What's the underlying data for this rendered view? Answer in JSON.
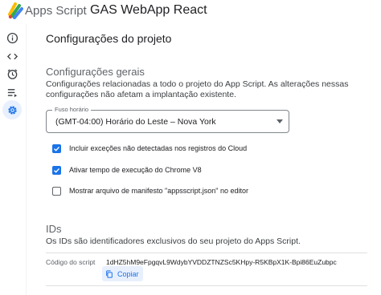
{
  "header": {
    "brand": "Apps Script",
    "project_name": "GAS WebApp React"
  },
  "rail": {
    "items": [
      {
        "icon": "info-icon",
        "active": false
      },
      {
        "icon": "code-icon",
        "active": false
      },
      {
        "icon": "clock-icon",
        "active": false
      },
      {
        "icon": "executions-icon",
        "active": false
      },
      {
        "icon": "gear-icon",
        "active": true
      }
    ]
  },
  "page": {
    "title": "Configurações do projeto"
  },
  "general": {
    "title": "Configurações gerais",
    "description": "Configurações relacionadas a todo o projeto do App Script. As alterações nessas configurações não afetam a implantação existente.",
    "timezone": {
      "label": "Fuso horário",
      "value": "(GMT-04:00) Horário do Leste – Nova York"
    },
    "options": [
      {
        "label": "Incluir exceções não detectadas nos registros do Cloud",
        "checked": true
      },
      {
        "label": "Ativar tempo de execução do Chrome V8",
        "checked": true
      },
      {
        "label": "Mostrar arquivo de manifesto \"appsscript.json\" no editor",
        "checked": false
      }
    ]
  },
  "ids": {
    "title": "IDs",
    "description": "Os IDs são identificadores exclusivos do seu projeto do Apps Script.",
    "script_label": "Código do script",
    "script_id": "1dHZ5hM9eFpgqvL9WdybYVDDZTNZSc5KHpy-R5KBpX1K-Bpi86EuZubpc",
    "copy_label": "Copiar"
  },
  "colors": {
    "accent": "#1a73e8",
    "active_bg": "#e8f0fe",
    "muted_text": "#5f6368"
  }
}
